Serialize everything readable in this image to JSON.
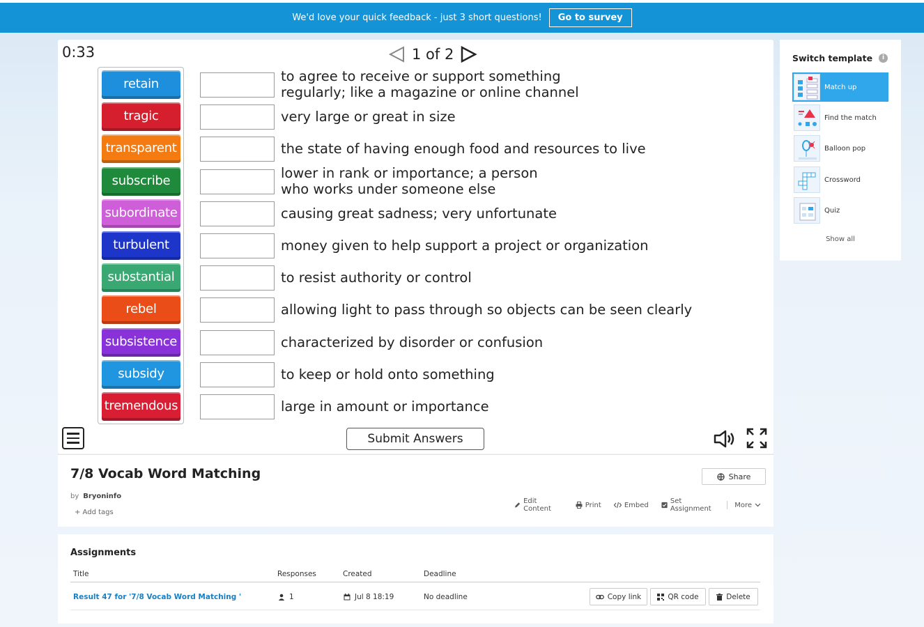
{
  "banner": {
    "text": "We'd love your quick feedback - just 3 short questions!",
    "button": "Go to survey"
  },
  "game": {
    "timer": "0:33",
    "page": "1 of 2",
    "words": [
      {
        "label": "retain",
        "color": "#1e8fdc"
      },
      {
        "label": "tragic",
        "color": "#d51f2f"
      },
      {
        "label": "transparent",
        "color": "#f47b12"
      },
      {
        "label": "subscribe",
        "color": "#1f8a3c"
      },
      {
        "label": "subordinate",
        "color": "#cf5fd9"
      },
      {
        "label": "turbulent",
        "color": "#1d36c9"
      },
      {
        "label": "substantial",
        "color": "#3aa872"
      },
      {
        "label": "rebel",
        "color": "#ea4d17"
      },
      {
        "label": "subsistence",
        "color": "#8a32d9"
      },
      {
        "label": "subsidy",
        "color": "#2196e0"
      },
      {
        "label": "tremendous",
        "color": "#d91d33"
      }
    ],
    "definitions": [
      {
        "line1": "to agree to receive or support something",
        "line2": "regularly; like a magazine or online channel"
      },
      {
        "line1": "very large or great in size",
        "line2": ""
      },
      {
        "line1": "the state of having enough food and resources to live",
        "line2": ""
      },
      {
        "line1": "lower in rank or importance; a person",
        "line2": "who works under someone else"
      },
      {
        "line1": "causing great sadness; very unfortunate",
        "line2": ""
      },
      {
        "line1": "money given to help support a project or organization",
        "line2": ""
      },
      {
        "line1": "to resist authority or control",
        "line2": ""
      },
      {
        "line1": "allowing light to pass through so objects can be seen clearly",
        "line2": ""
      },
      {
        "line1": "characterized by disorder or confusion",
        "line2": ""
      },
      {
        "line1": "to keep or hold onto something",
        "line2": ""
      },
      {
        "line1": "large in amount or importance",
        "line2": ""
      }
    ],
    "submit": "Submit Answers"
  },
  "info": {
    "title": "7/8 Vocab Word Matching",
    "by": "by",
    "author": "Bryoninfo",
    "add_tags": "+ Add tags",
    "share": "Share",
    "actions": {
      "edit": "Edit Content",
      "print": "Print",
      "embed": "Embed",
      "set_assignment": "Set Assignment",
      "more": "More"
    }
  },
  "assignments": {
    "title": "Assignments",
    "headers": {
      "title": "Title",
      "responses": "Responses",
      "created": "Created",
      "deadline": "Deadline"
    },
    "rows": [
      {
        "title": "Result 47 for '7/8 Vocab Word Matching '",
        "responses": "1",
        "created": "Jul 8 18:19",
        "deadline": "No deadline"
      }
    ],
    "buttons": {
      "copy": "Copy link",
      "qr": "QR code",
      "delete": "Delete"
    }
  },
  "sidebar": {
    "title": "Switch template",
    "templates": [
      {
        "label": "Match up",
        "active": true
      },
      {
        "label": "Find the match",
        "active": false
      },
      {
        "label": "Balloon pop",
        "active": false
      },
      {
        "label": "Crossword",
        "active": false
      },
      {
        "label": "Quiz",
        "active": false
      }
    ],
    "show_all": "Show all"
  }
}
